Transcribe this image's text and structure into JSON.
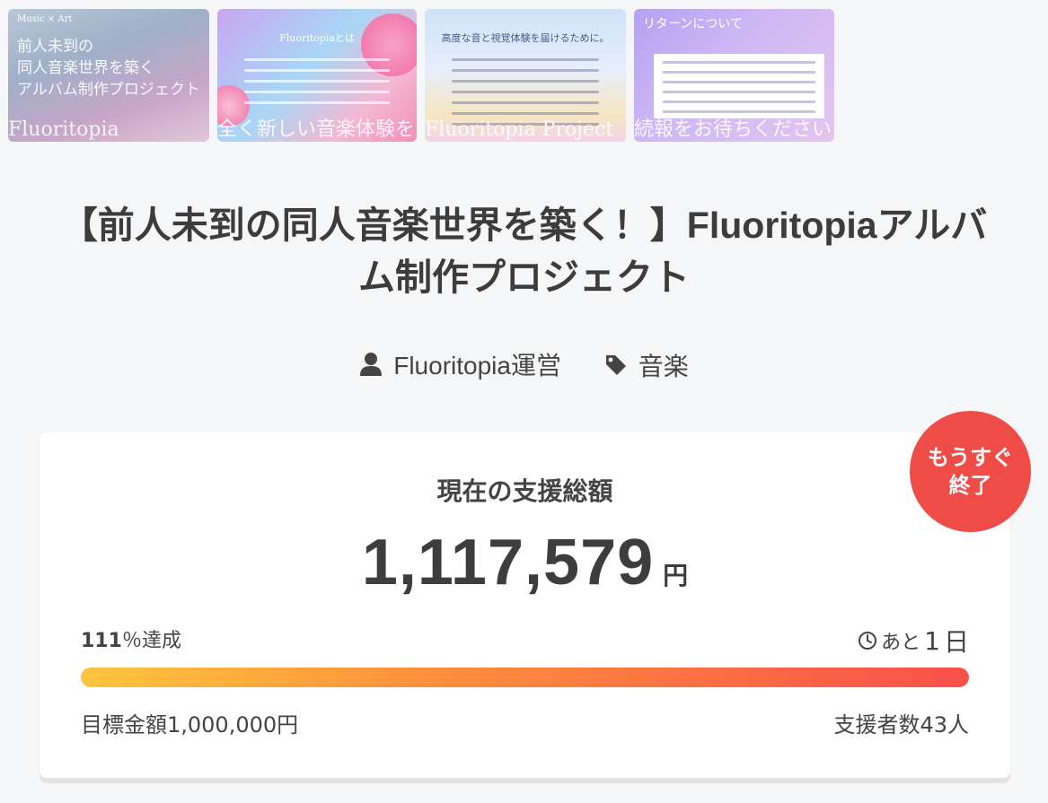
{
  "gallery": [
    {
      "title_lines": [
        "前人未到の",
        "同人音楽世界を築く",
        "アルバム制作プロジェクト"
      ],
      "caption": "Music × Art",
      "strip": "Fluoritopia"
    },
    {
      "caption": "Fluoritopiaとは",
      "strip": "全く新しい音楽体験を"
    },
    {
      "caption": "高度な音と視覚体験を届けるために。",
      "strip": "Fluoritopia Project"
    },
    {
      "caption": "リターンについて",
      "strip": "続報をお待ちください"
    }
  ],
  "project": {
    "title": "【前人未到の同人音楽世界を築く！】Fluoritopiaアルバム制作プロジェクト",
    "owner": "Fluoritopia運営",
    "category": "音楽",
    "owner_icon": "user-icon",
    "category_icon": "tag-icon"
  },
  "funding": {
    "label": "現在の支援総額",
    "amount": "1,117,579",
    "unit": "円",
    "percent_value": "111",
    "percent_suffix": "％達成",
    "progress": 1.0,
    "remain_prefix": "あと",
    "remain_days": "1",
    "remain_unit": "日",
    "goal": "目標金額1,000,000円",
    "backers": "支援者数43人"
  },
  "badge": {
    "line1": "もうすぐ",
    "line2": "終了"
  },
  "colors": {
    "accent": "#ef4b47",
    "bar_start": "#ffc53d",
    "bar_end": "#f8504a"
  }
}
